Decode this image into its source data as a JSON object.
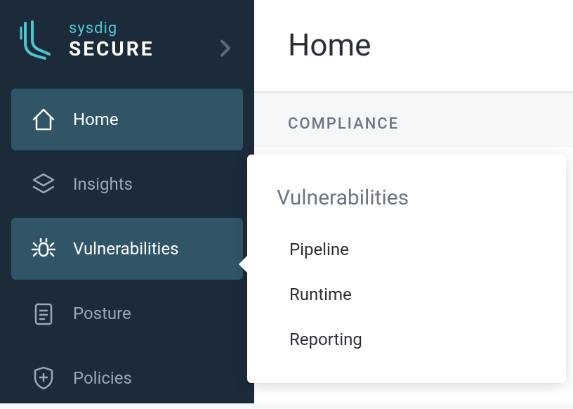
{
  "brand": {
    "line1": "sysdig",
    "line2": "SECURE"
  },
  "sidebar": {
    "items": [
      {
        "label": "Home",
        "icon": "home"
      },
      {
        "label": "Insights",
        "icon": "layers"
      },
      {
        "label": "Vulnerabilities",
        "icon": "bug"
      },
      {
        "label": "Posture",
        "icon": "clipboard"
      },
      {
        "label": "Policies",
        "icon": "shield-plus"
      }
    ]
  },
  "main": {
    "title": "Home",
    "section": "COMPLIANCE"
  },
  "flyout": {
    "title": "Vulnerabilities",
    "items": [
      "Pipeline",
      "Runtime",
      "Reporting"
    ]
  }
}
